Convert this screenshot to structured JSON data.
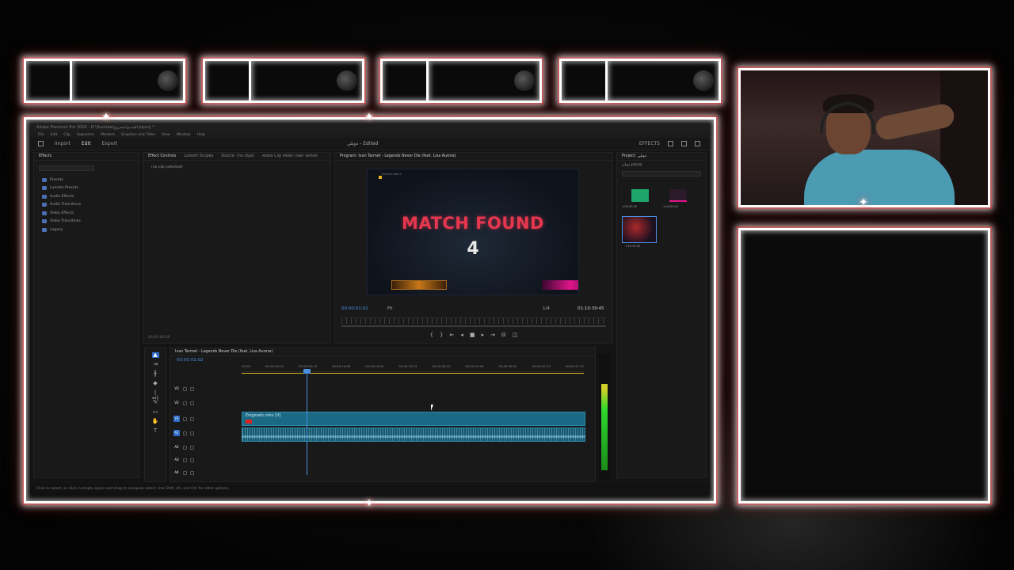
{
  "app": {
    "title_bar": "Adobe Premiere Pro 2024 - D:\\Youtube\\الفيديو\\مشروع.prproj *",
    "menus": [
      "File",
      "Edit",
      "Clip",
      "Sequence",
      "Markers",
      "Graphics and Titles",
      "View",
      "Window",
      "Help"
    ],
    "header_tabs": [
      "Import",
      "Edit",
      "Export"
    ],
    "active_header_tab": "Edit",
    "document_title": "ذوبلي - Edited",
    "header_right": "EFFECTS"
  },
  "effects_panel": {
    "tab": "Effects",
    "items": [
      "Presets",
      "Lumetri Presets",
      "Audio Effects",
      "Audio Transitions",
      "Video Effects",
      "Video Transitions",
      "Legacy"
    ]
  },
  "effect_controls": {
    "tabs": [
      "Effect Controls",
      "Lumetri Scopes",
      "Source: (no clips)",
      "Audio Clip Mixer: Ivan Tarmet - Legends Never Die (feat. Lisa Aurora)"
    ],
    "empty_text": "(no clip selected)",
    "timecode": "00:00:00:00"
  },
  "program_monitor": {
    "tab": "Program: Ivan Tarmet - Legends Never Die (feat. Lisa Aurora)",
    "preview": {
      "headline": "MATCH FOUND",
      "countdown": "4",
      "mini_label": "Ranked Match"
    },
    "timecode_current": "00:00:01:02",
    "fit": "Fit",
    "quality": "1/4",
    "timecode_duration": "01:10:39:45"
  },
  "project_panel": {
    "tab": "Project: ذوبلي",
    "subtitle": "ذوبلي.prproj",
    "assets": [
      {
        "name": "Intro",
        "meta": "1:00:00:00"
      },
      {
        "name": "Sequence 01",
        "meta": "1:00:00:00"
      },
      {
        "name": "Ivan Tarmet",
        "meta": "1:40:35:45"
      }
    ]
  },
  "timeline": {
    "tab": "Ivan Tarmet - Legends Never Die (feat. Lisa Aurora)",
    "timecode": "00:00:01:02",
    "ruler": [
      "00:00",
      "00:00:04:22",
      "00:00:09:15",
      "00:00:14:08",
      "00:00:19:00",
      "00:00:23:23",
      "00:00:28:15",
      "00:00:33:08",
      "00:00:38:00",
      "00:00:42:23",
      "00:00:47:15"
    ],
    "tracks": [
      {
        "label": "V3",
        "on": false
      },
      {
        "label": "V2",
        "on": false
      },
      {
        "label": "V1",
        "on": true
      },
      {
        "label": "A1",
        "on": true
      },
      {
        "label": "A2",
        "on": false
      },
      {
        "label": "A3",
        "on": false
      },
      {
        "label": "A4",
        "on": false
      }
    ],
    "video_clip": "Enigmatic.mkv [V]",
    "audio_level": 0.68
  },
  "status": "Click to select, or click in empty space and drag to marquee select. Use Shift, Alt, and Ctrl for other options.",
  "colors": {
    "accent": "#2d6cc7",
    "headline": "#e6374e",
    "clip": "#1b6a85"
  }
}
